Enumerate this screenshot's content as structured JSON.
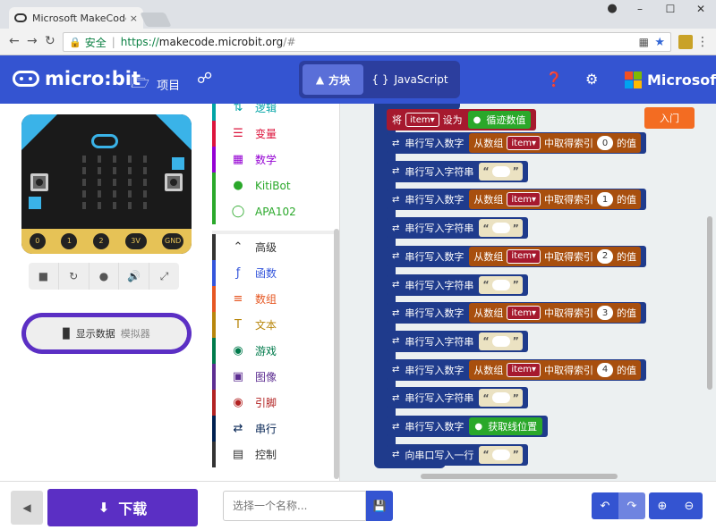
{
  "browser": {
    "tab_title": "Microsoft MakeCode fo",
    "tab_close": "×",
    "window_controls": [
      "–",
      "☐",
      "✕"
    ],
    "secure_label": "安全",
    "url_proto": "https://",
    "url_host": "makecode.microbit.org",
    "url_path": "/#"
  },
  "header": {
    "logo_text": "micro:bit",
    "projects_label": "项目",
    "modes": [
      {
        "label": "方块",
        "active": true
      },
      {
        "label": "JavaScript",
        "active": false
      }
    ],
    "brand": "Microsoft",
    "brand_colors": [
      "#f25022",
      "#7fba00",
      "#00a4ef",
      "#ffb900"
    ]
  },
  "simulator": {
    "pins": [
      "0",
      "1",
      "2",
      "3V",
      "GND"
    ],
    "data_label": "显示数据",
    "data_suffix": "模拟器"
  },
  "toolbox": {
    "categories": [
      {
        "label": "逻辑",
        "color": "#00a4a6",
        "icon": "logic-icon"
      },
      {
        "label": "变量",
        "color": "#dc143c",
        "icon": "variable-icon"
      },
      {
        "label": "数学",
        "color": "#9400d3",
        "icon": "math-icon"
      },
      {
        "label": "KitiBot",
        "color": "#2aa82a",
        "icon": "robot-icon"
      },
      {
        "label": "APA102",
        "color": "#2aa82a",
        "icon": "ring-icon"
      },
      {
        "label": "高级",
        "color": "#333333",
        "icon": "chevron-up-icon"
      },
      {
        "label": "函数",
        "color": "#3455db",
        "icon": "function-icon"
      },
      {
        "label": "数组",
        "color": "#e65722",
        "icon": "array-icon"
      },
      {
        "label": "文本",
        "color": "#b8860b",
        "icon": "text-icon"
      },
      {
        "label": "游戏",
        "color": "#007a4b",
        "icon": "gamepad-icon"
      },
      {
        "label": "图像",
        "color": "#5c2d91",
        "icon": "image-icon"
      },
      {
        "label": "引脚",
        "color": "#b22222",
        "icon": "pin-icon"
      },
      {
        "label": "串行",
        "color": "#002050",
        "icon": "usb-icon"
      },
      {
        "label": "控制",
        "color": "#333333",
        "icon": "control-icon"
      }
    ]
  },
  "workspace": {
    "entry_label": "入门",
    "set_prefix": "将",
    "item_var": "item",
    "set_mid": "设为",
    "scan_label": "循迹数值",
    "serial_number": "串行写入数字",
    "serial_string": "串行写入字符串",
    "serial_line": "向串口写入一行",
    "from_array": "从数组",
    "get_index": "中取得索引",
    "value_suffix": "的值",
    "indexes": [
      "0",
      "1",
      "2",
      "3",
      "4"
    ],
    "position_label": "获取线位置",
    "quote_open": "“",
    "quote_close": "”"
  },
  "bottom": {
    "download_label": "下载",
    "name_placeholder": "选择一个名称..."
  }
}
